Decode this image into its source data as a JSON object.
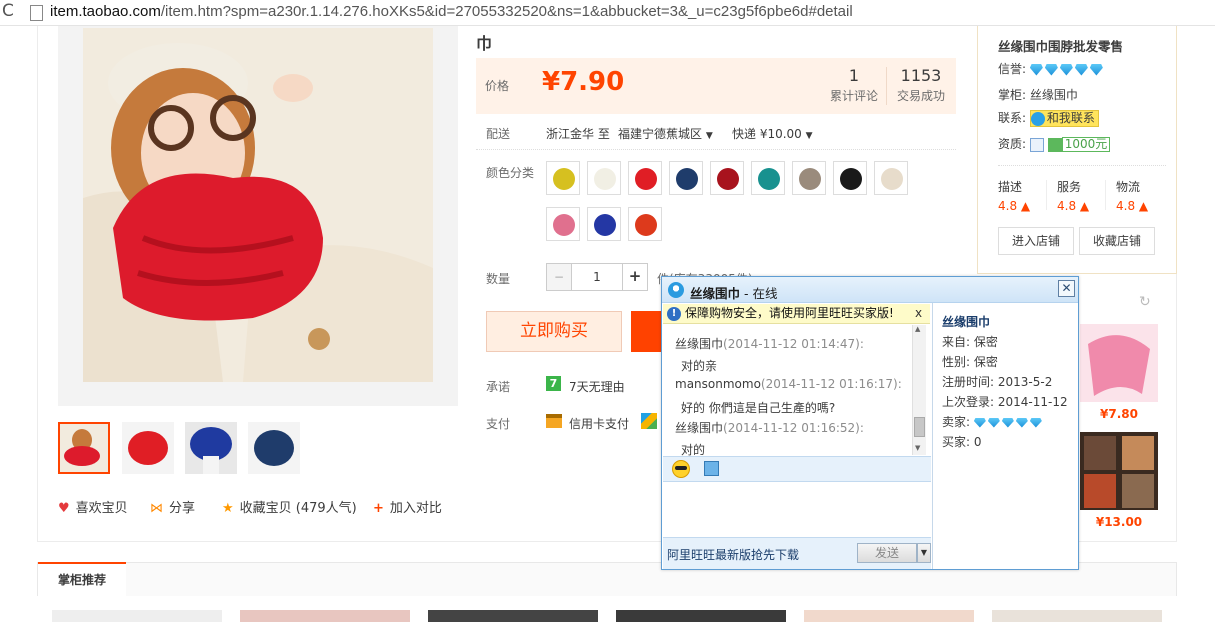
{
  "browser": {
    "url_host": "item.taobao.com",
    "url_rest": "/item.htm?spm=a230r.1.14.276.hoXKs5&id=27055332520&ns=1&abbucket=3&_u=c23g5f6pbe6d#detail"
  },
  "product": {
    "title": "巾",
    "price_label": "价格",
    "price": "¥7.90",
    "reviews_count": "1",
    "reviews_label": "累计评论",
    "sales_count": "1153",
    "sales_label": "交易成功",
    "shipping_label": "配送",
    "ship_from": "浙江金华 至",
    "ship_to": "福建宁德蕉城区",
    "ship_method": "快递 ¥10.00",
    "color_label": "颜色分类",
    "swatches": [
      "#d6c020",
      "#f1efe4",
      "#e01e25",
      "#1f3c6b",
      "#a8131d",
      "#18918f",
      "#9a8b7c",
      "#1a1a1a",
      "#e7dccb",
      "#e0708e",
      "#2437a4",
      "#dd3a1c"
    ],
    "qty_label": "数量",
    "qty_value": "1",
    "qty_minus": "−",
    "qty_plus": "+",
    "stock_text": "件(库存33005件)",
    "buy_label": "立即购买",
    "promise_label": "承诺",
    "promise_text": "7天无理由",
    "pay_label": "支付",
    "pay_text": "信用卡支付"
  },
  "actions": {
    "like": "喜欢宝贝",
    "share": "分享",
    "fav": "收藏宝贝 (479人气)",
    "compare": "加入对比"
  },
  "shop": {
    "name": "丝缘围巾围脖批发零售",
    "rep_label": "信誉:",
    "owner_label": "掌柜:",
    "owner": "丝缘围巾",
    "contact_label": "联系:",
    "contact_btn": "和我联系",
    "qual_label": "资质:",
    "deposit": "1000元",
    "scores": [
      {
        "label": "描述",
        "value": "4.8"
      },
      {
        "label": "服务",
        "value": "4.8"
      },
      {
        "label": "物流",
        "value": "4.8"
      }
    ],
    "enter_btn": "进入店铺",
    "fav_btn": "收藏店铺"
  },
  "related": {
    "prices": [
      "¥7.80",
      "¥13.00"
    ]
  },
  "bottom": {
    "tab": "掌柜推荐"
  },
  "chat": {
    "title_name": "丝缘围巾",
    "title_status": " - 在线",
    "warning": "保障购物安全，请使用阿里旺旺买家版!",
    "warning_close": "x",
    "messages": [
      {
        "user": "丝缘围巾",
        "date": "(2014-11-12 01:14:47):",
        "text": "对的亲"
      },
      {
        "user": "mansonmomo",
        "date": "(2014-11-12 01:16:17):",
        "text": "好的 你們這是自己生產的嗎?"
      },
      {
        "user": "丝缘围巾",
        "date": "(2014-11-12 01:16:52):",
        "text": "对的"
      }
    ],
    "side": {
      "name": "丝缘围巾",
      "from": "来自: 保密",
      "gender": "性别: 保密",
      "reg": "注册时间: 2013-5-2",
      "last": "上次登录: 2014-11-12",
      "seller": "卖家:",
      "buyer": "买家: 0"
    },
    "footer_link": "阿里旺旺最新版抢先下载",
    "send_label": "发送"
  }
}
